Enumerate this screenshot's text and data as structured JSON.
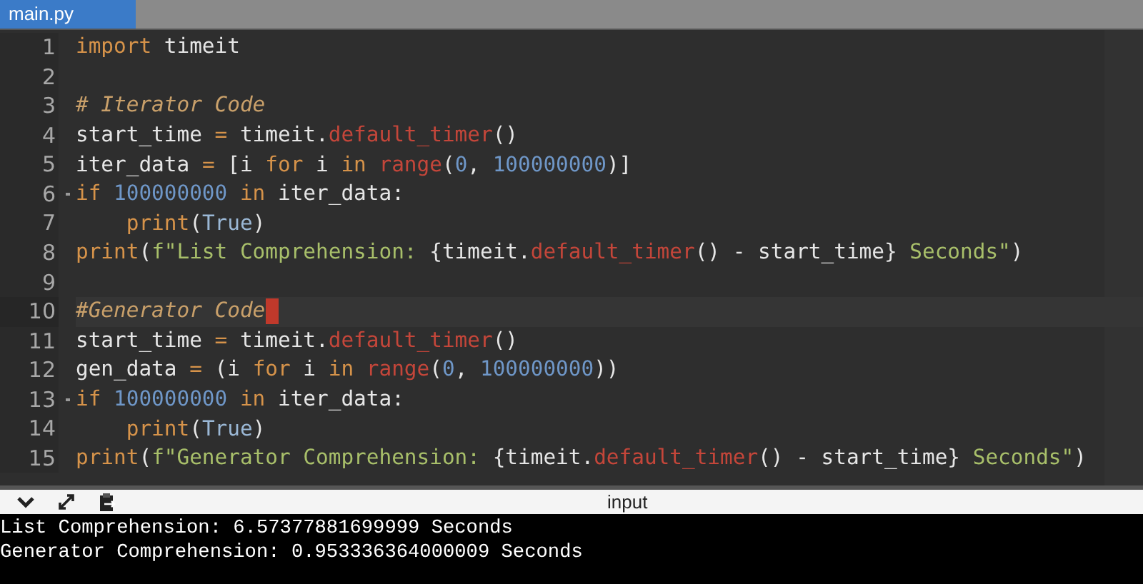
{
  "tabs": [
    {
      "label": "main.py",
      "selected": true
    }
  ],
  "editor": {
    "lines": [
      {
        "number": "1",
        "fold": false,
        "cursor": false,
        "tokens": [
          {
            "kind": "keyword",
            "text": "import"
          },
          {
            "kind": "plain",
            "text": " timeit"
          }
        ]
      },
      {
        "number": "2",
        "fold": false,
        "cursor": false
      },
      {
        "number": "3",
        "fold": false,
        "cursor": false,
        "tokens": [
          {
            "kind": "comment",
            "text": "# Iterator Code"
          }
        ]
      },
      {
        "number": "4",
        "fold": false,
        "cursor": false,
        "tokens": [
          {
            "kind": "plain",
            "text": "start_time "
          },
          {
            "kind": "operator",
            "text": "="
          },
          {
            "kind": "plain",
            "text": " timeit."
          },
          {
            "kind": "function",
            "text": "default_timer"
          },
          {
            "kind": "plain",
            "text": "()"
          }
        ]
      },
      {
        "number": "5",
        "fold": false,
        "cursor": false,
        "tokens": [
          {
            "kind": "plain",
            "text": "iter_data "
          },
          {
            "kind": "operator",
            "text": "="
          },
          {
            "kind": "plain",
            "text": " [i "
          },
          {
            "kind": "keyword",
            "text": "for"
          },
          {
            "kind": "plain",
            "text": " i "
          },
          {
            "kind": "keyword",
            "text": "in "
          },
          {
            "kind": "function",
            "text": "range"
          },
          {
            "kind": "plain",
            "text": "("
          },
          {
            "kind": "number",
            "text": "0"
          },
          {
            "kind": "plain",
            "text": ", "
          },
          {
            "kind": "number",
            "text": "100000000"
          },
          {
            "kind": "plain",
            "text": ")]"
          }
        ]
      },
      {
        "number": "6",
        "fold": true,
        "cursor": false,
        "tokens": [
          {
            "kind": "keyword",
            "text": "if "
          },
          {
            "kind": "number",
            "text": "100000000 "
          },
          {
            "kind": "keyword",
            "text": "in"
          },
          {
            "kind": "plain",
            "text": " iter_data:"
          }
        ]
      },
      {
        "number": "7",
        "fold": false,
        "cursor": false,
        "tokens": [
          {
            "kind": "keyword",
            "text": "    print"
          },
          {
            "kind": "plain",
            "text": "("
          },
          {
            "kind": "constant",
            "text": "True"
          },
          {
            "kind": "plain",
            "text": ")"
          }
        ]
      },
      {
        "number": "8",
        "fold": false,
        "cursor": false,
        "tokens": [
          {
            "kind": "keyword",
            "text": "print"
          },
          {
            "kind": "plain",
            "text": "("
          },
          {
            "kind": "string",
            "text": "f\"List Comprehension: "
          },
          {
            "kind": "plain",
            "text": "{timeit."
          },
          {
            "kind": "function",
            "text": "default_timer"
          },
          {
            "kind": "plain",
            "text": "() - start_time}"
          },
          {
            "kind": "string",
            "text": " Seconds\""
          },
          {
            "kind": "plain",
            "text": ")"
          }
        ]
      },
      {
        "number": "9",
        "fold": false,
        "cursor": false
      },
      {
        "number": "10",
        "fold": false,
        "cursor": true,
        "tokens": [
          {
            "kind": "comment",
            "text": "#Generator Code"
          }
        ]
      },
      {
        "number": "11",
        "fold": false,
        "cursor": false,
        "tokens": [
          {
            "kind": "plain",
            "text": "start_time "
          },
          {
            "kind": "operator",
            "text": "="
          },
          {
            "kind": "plain",
            "text": " timeit."
          },
          {
            "kind": "function",
            "text": "default_timer"
          },
          {
            "kind": "plain",
            "text": "()"
          }
        ]
      },
      {
        "number": "12",
        "fold": false,
        "cursor": false,
        "tokens": [
          {
            "kind": "plain",
            "text": "gen_data "
          },
          {
            "kind": "operator",
            "text": "="
          },
          {
            "kind": "plain",
            "text": " (i "
          },
          {
            "kind": "keyword",
            "text": "for"
          },
          {
            "kind": "plain",
            "text": " i "
          },
          {
            "kind": "keyword",
            "text": "in "
          },
          {
            "kind": "function",
            "text": "range"
          },
          {
            "kind": "plain",
            "text": "("
          },
          {
            "kind": "number",
            "text": "0"
          },
          {
            "kind": "plain",
            "text": ", "
          },
          {
            "kind": "number",
            "text": "100000000"
          },
          {
            "kind": "plain",
            "text": "))"
          }
        ]
      },
      {
        "number": "13",
        "fold": true,
        "cursor": false,
        "tokens": [
          {
            "kind": "keyword",
            "text": "if "
          },
          {
            "kind": "number",
            "text": "100000000 "
          },
          {
            "kind": "keyword",
            "text": "in"
          },
          {
            "kind": "plain",
            "text": " iter_data:"
          }
        ]
      },
      {
        "number": "14",
        "fold": false,
        "cursor": false,
        "tokens": [
          {
            "kind": "keyword",
            "text": "    print"
          },
          {
            "kind": "plain",
            "text": "("
          },
          {
            "kind": "constant",
            "text": "True"
          },
          {
            "kind": "plain",
            "text": ")"
          }
        ]
      },
      {
        "number": "15",
        "fold": false,
        "cursor": false,
        "tokens": [
          {
            "kind": "keyword",
            "text": "print"
          },
          {
            "kind": "plain",
            "text": "("
          },
          {
            "kind": "string",
            "text": "f\"Generator Comprehension: "
          },
          {
            "kind": "plain",
            "text": "{timeit."
          },
          {
            "kind": "function",
            "text": "default_timer"
          },
          {
            "kind": "plain",
            "text": "() - start_time}"
          },
          {
            "kind": "string",
            "text": " Seconds\""
          },
          {
            "kind": "plain",
            "text": ")"
          }
        ]
      }
    ]
  },
  "console": {
    "title": "input",
    "output": [
      "List Comprehension: 6.57377881699999 Seconds",
      "Generator Comprehension: 0.953336364000009 Seconds"
    ]
  }
}
